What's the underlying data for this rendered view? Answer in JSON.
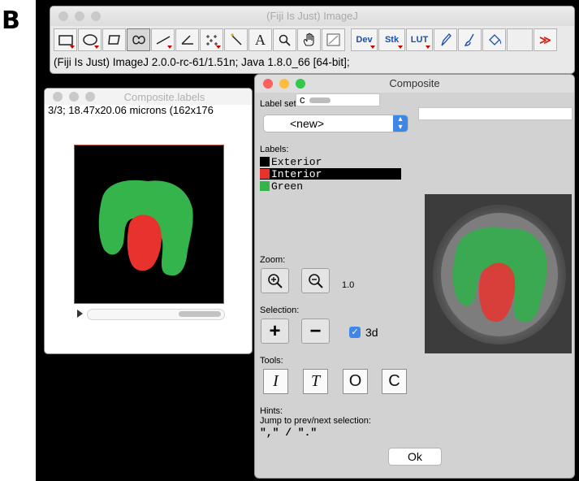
{
  "figure": {
    "panel_label": "B"
  },
  "imagej": {
    "title": "(Fiji Is Just) ImageJ",
    "status": "(Fiji Is Just) ImageJ 2.0.0-rc-61/1.51n; Java 1.8.0_66 [64-bit];",
    "tools": [
      "rectangle-tool",
      "oval-tool",
      "polygon-tool",
      "freehand-tool",
      "line-tool",
      "angle-tool",
      "point-tool",
      "wand-tool",
      "text-tool",
      "magnifier-tool",
      "hand-tool",
      "color-picker-tool"
    ],
    "text_tool_glyph": "A",
    "dev_label": "Dev",
    "stk_label": "Stk",
    "lut_label": "LUT",
    "more_glyph": "≫"
  },
  "labels_window": {
    "title": "Composite.labels",
    "info": "3/3; 18.47x20.06 microns (162x176"
  },
  "composite_window": {
    "title": "Composite",
    "c_field": "c",
    "label_sets_label": "Label sets:",
    "label_set_value": "<new>",
    "labels_heading": "Labels:",
    "labels": [
      {
        "name": "Exterior",
        "color": "#000000",
        "selected": false
      },
      {
        "name": "Interior",
        "color": "#e8322e",
        "selected": true
      },
      {
        "name": "Green",
        "color": "#34b44a",
        "selected": false
      }
    ],
    "zoom_label": "Zoom:",
    "zoom_value": "1.0",
    "selection_label": "Selection:",
    "plus_glyph": "+",
    "minus_glyph": "−",
    "three_d_label": "3d",
    "three_d_checked": true,
    "tools_label": "Tools:",
    "tool_buttons": [
      "I",
      "T",
      "O",
      "C"
    ],
    "hints_label": "Hints:",
    "hints_text": "Jump to prev/next selection:",
    "hints_keys": "\",\" / \".\"",
    "ok_label": "Ok"
  },
  "colors": {
    "interior": "#e8322e",
    "green": "#34b44a",
    "accent": "#3e86e8"
  }
}
